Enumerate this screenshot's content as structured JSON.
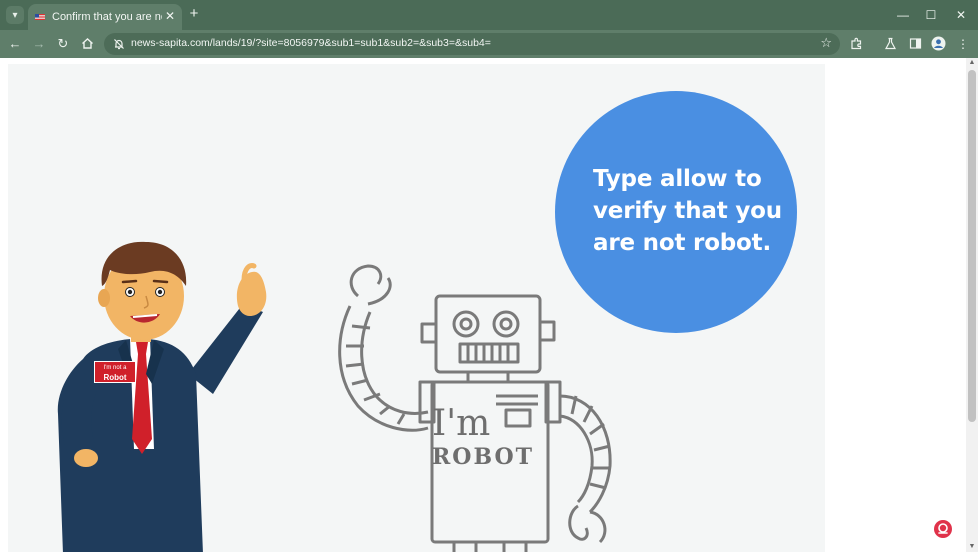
{
  "browser": {
    "tab": {
      "title": "Confirm that you are not a robot"
    },
    "address": {
      "url": "news-sapita.com/lands/19/?site=8056979&sub1=sub1&sub2=&sub3=&sub4="
    },
    "colors": {
      "frame": "#4b6b57",
      "toolbar": "#5f7e6a"
    }
  },
  "page": {
    "message": "Type allow to verify that you are not robot.",
    "badge": {
      "line1": "I'm not a",
      "line2": "Robot"
    },
    "robot_text": {
      "line1": "I'm",
      "line2": "ROBOT"
    },
    "colors": {
      "bubble": "#4a8fe2",
      "background": "#f4f6f6",
      "suit": "#1f3c5c",
      "tie": "#d0202a"
    }
  }
}
